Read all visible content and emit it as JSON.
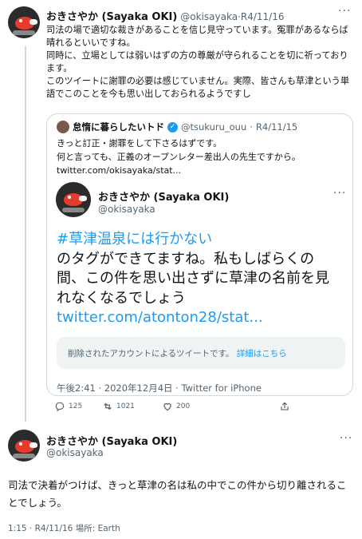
{
  "tweet1": {
    "display_name": "おきさやか (Sayaka OKI)",
    "handle": "@okisayaka",
    "separator": "·",
    "date": "R4/11/16",
    "body_lines": [
      "司法の場で適切な裁きがあることを信じ見守っています。冤罪があるならば晴れるといいですね。",
      "同時に、立場としては弱いはずの方の尊厳が守られることを切に祈っております。",
      "このツイートに謝罪の必要は感じていません。実際、皆さんも草津という単語でこのことを今も思い出しておられるようですし"
    ]
  },
  "quoted": {
    "display_name": "怠惰に暮らしたいトド",
    "verified_mark": "✓",
    "handle": "@tsukuru_ouu",
    "separator": "·",
    "date": "R4/11/15",
    "line1": "きっと訂正・謝罪をして下さるはずです。",
    "line2": "何と言っても、正義のオープンレター差出人の先生ですから。",
    "link": "twitter.com/okisayaka/stat..."
  },
  "inner": {
    "display_name": "おきさやか (Sayaka OKI)",
    "handle": "@okisayaka",
    "hashtag": "#草津温泉には行かない",
    "text": "のタグができてますね。私もしばらくの間、この件を思い出さずに草津の名前を見れなくなるでしょう",
    "url": "twitter.com/atonton28/stat...",
    "deleted_text": "削除されたアカウントによるツイートです。",
    "deleted_link": "詳細はこちら",
    "timestamp": "午後2:41 · 2020年12月4日 · Twitter for iPhone"
  },
  "actions": {
    "replies": "125",
    "retweets": "1021",
    "likes": "200"
  },
  "tweet2": {
    "display_name": "おきさやか (Sayaka OKI)",
    "handle": "@okisayaka",
    "body": "司法で決着がつけば、きっと草津の名は私の中でこの件から切り離されることでしょう。",
    "meta": "1:15 · R4/11/16 場所: Earth"
  },
  "more_icon": "···",
  "colors": {
    "link": "#1d9bf0",
    "muted": "#536471",
    "border": "#cfd9de",
    "avatar_bird": "#e53b2c"
  }
}
